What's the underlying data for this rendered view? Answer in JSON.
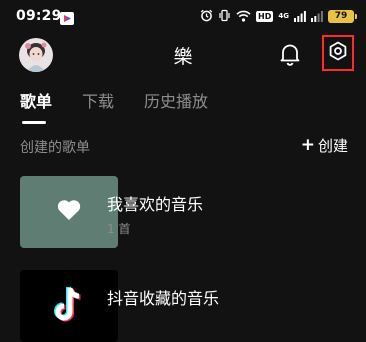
{
  "status_bar": {
    "time": "09:29",
    "network_hd": "HD",
    "network_type": "4G",
    "battery": "79"
  },
  "header": {
    "title": "樂"
  },
  "tabs": [
    {
      "label": "歌单",
      "active": true
    },
    {
      "label": "下载",
      "active": false
    },
    {
      "label": "历史播放",
      "active": false
    }
  ],
  "section": {
    "title": "创建的歌单",
    "create_label": "创建",
    "create_icon": "+"
  },
  "playlists": [
    {
      "title": "我喜欢的音乐",
      "subtitle": "1 首",
      "icon": "heart-icon"
    },
    {
      "title": "抖音收藏的音乐",
      "subtitle": "",
      "icon": "douyin-logo"
    }
  ],
  "colors": {
    "background": "#121212",
    "highlight_box": "#ff2a2a",
    "liked_thumb": "#5f7d72",
    "battery": "#e8c240"
  }
}
